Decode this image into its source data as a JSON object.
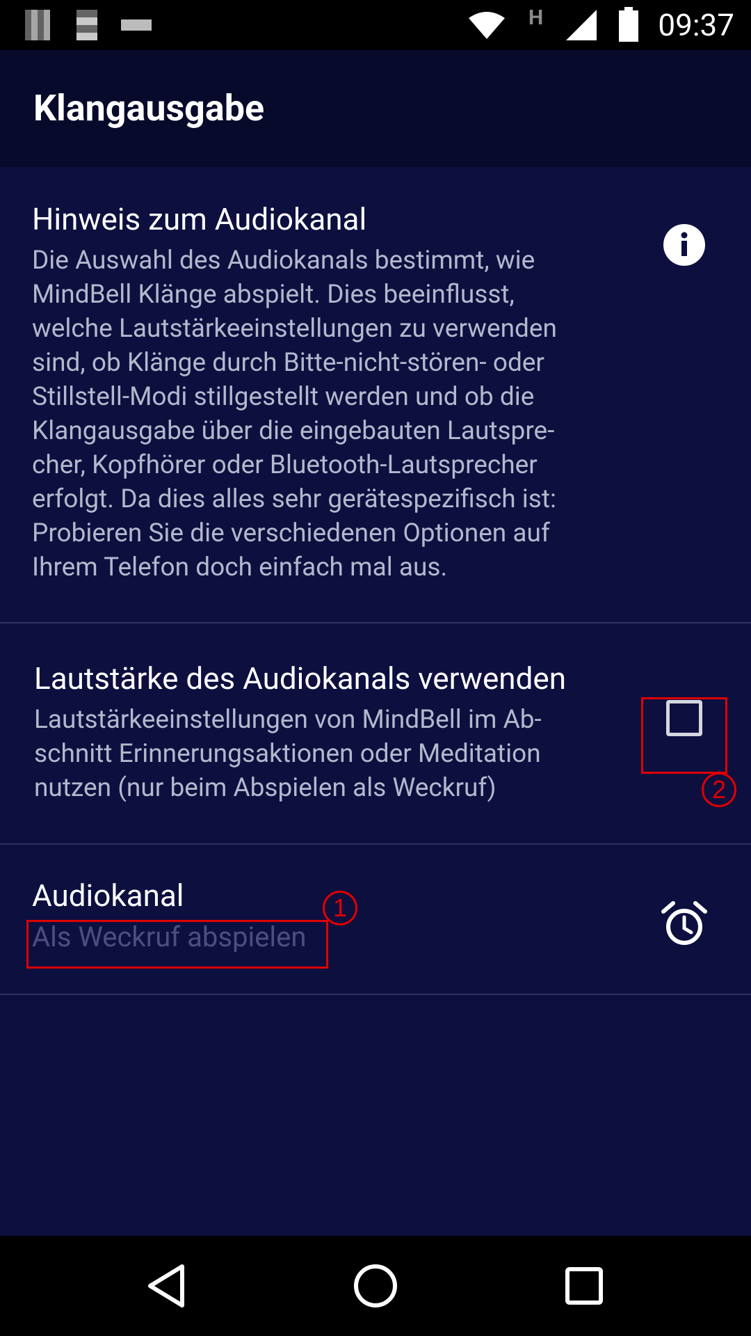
{
  "status_bar": {
    "time": "09:37",
    "network_type": "H",
    "icons": [
      "wifi-icon",
      "cellular-signal-icon",
      "battery-icon"
    ]
  },
  "app_bar": {
    "title": "Klangausgabe"
  },
  "preferences": [
    {
      "title": "Hinweis zum Audiokanal",
      "summary_lines": [
        "Die Auswahl des Audiokanals bestimmt, wie",
        "MindBell Klänge abspielt. Dies beeinflusst,",
        "welche Lautstärkeeinstellungen zu verwenden",
        "sind, ob Klänge durch Bitte-nicht-stören- oder",
        "Stillstell-Modi stillgestellt werden und ob die",
        "Klangausgabe über die eingebauten Lautspre-",
        "cher, Kopfhörer oder Bluetooth-Lautsprecher",
        "erfolgt. Da dies alles sehr gerätespezifisch ist:",
        "Probieren Sie die verschiedenen Optionen auf",
        "Ihrem Telefon doch einfach mal aus."
      ],
      "icon": "info-icon"
    },
    {
      "title": "Lautstärke des Audiokanals verwenden",
      "summary_lines": [
        "Lautstärkeeinstellungen von MindBell im Ab-",
        "schnitt Erinnerungsaktionen oder Meditation",
        "nutzen (nur beim Abspielen als Weckruf)"
      ],
      "checked": false
    },
    {
      "title": "Audiokanal",
      "summary": "Als Weckruf abspielen",
      "icon": "alarm-clock-icon"
    }
  ],
  "annotations": [
    {
      "label": "1",
      "color": "#e00000"
    },
    {
      "label": "2",
      "color": "#e00000"
    }
  ],
  "colors": {
    "background": "#0d0f3f",
    "app_bar": "#070a2b",
    "annotation": "#e00000"
  }
}
